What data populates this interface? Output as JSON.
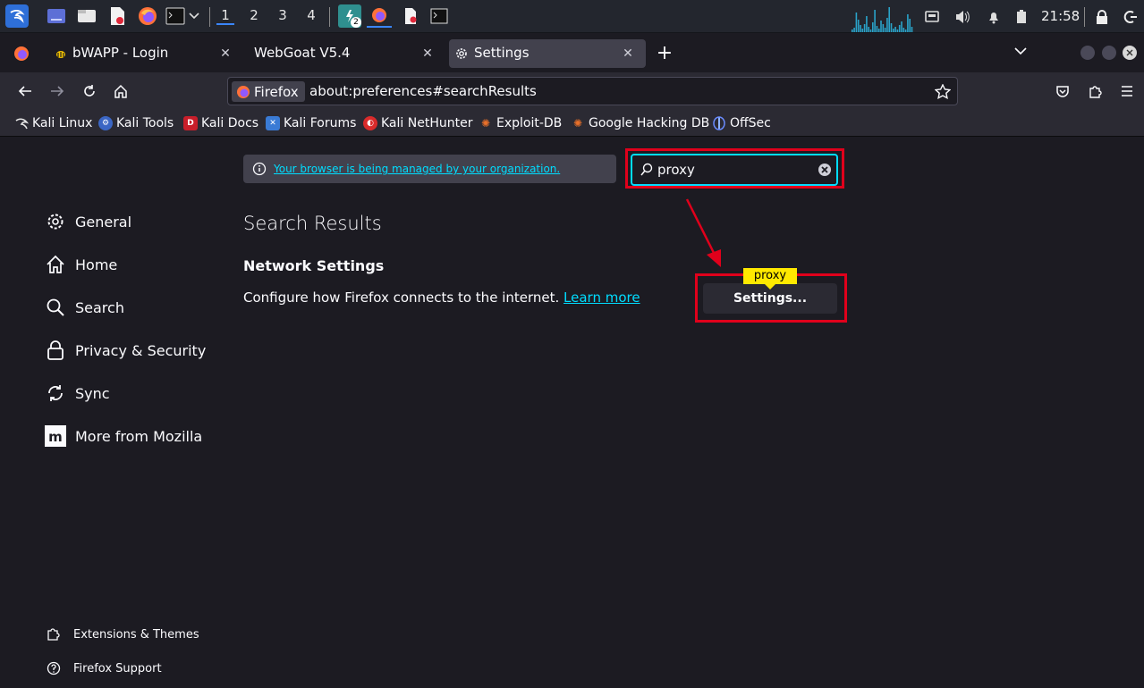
{
  "taskbar": {
    "workspaces": [
      "1",
      "2",
      "3",
      "4"
    ],
    "active_workspace": "1",
    "badge_count": "2",
    "clock": "21:58"
  },
  "tabs": [
    {
      "label": "bWAPP - Login",
      "selected": false
    },
    {
      "label": "WebGoat V5.4",
      "selected": false
    },
    {
      "label": "Settings",
      "selected": true
    }
  ],
  "navbar": {
    "identity_label": "Firefox",
    "url": "about:preferences#searchResults"
  },
  "bookmarks": [
    {
      "label": "Kali Linux",
      "icon": "kali-dragon-icon"
    },
    {
      "label": "Kali Tools",
      "icon": "kali-tools-icon"
    },
    {
      "label": "Kali Docs",
      "icon": "kali-docs-icon"
    },
    {
      "label": "Kali Forums",
      "icon": "kali-forums-icon"
    },
    {
      "label": "Kali NetHunter",
      "icon": "nethunter-icon"
    },
    {
      "label": "Exploit-DB",
      "icon": "exploitdb-icon"
    },
    {
      "label": "Google Hacking DB",
      "icon": "ghdb-icon"
    },
    {
      "label": "OffSec",
      "icon": "offsec-icon"
    }
  ],
  "prefs": {
    "managed_notice": "Your browser is being managed by your organization.",
    "search_value": "proxy",
    "categories": [
      "General",
      "Home",
      "Search",
      "Privacy & Security",
      "Sync",
      "More from Mozilla"
    ],
    "footer": [
      "Extensions & Themes",
      "Firefox Support"
    ],
    "results_title": "Search Results",
    "section_title": "Network Settings",
    "section_desc": "Configure how Firefox connects to the internet.",
    "learn_more": "Learn more",
    "settings_button": "Settings...",
    "tooltip": "proxy"
  },
  "colors": {
    "accent": "#00ddff",
    "highlight_box": "#e0001b",
    "tooltip_bg": "#ffe900",
    "background": "#1c1b22"
  }
}
